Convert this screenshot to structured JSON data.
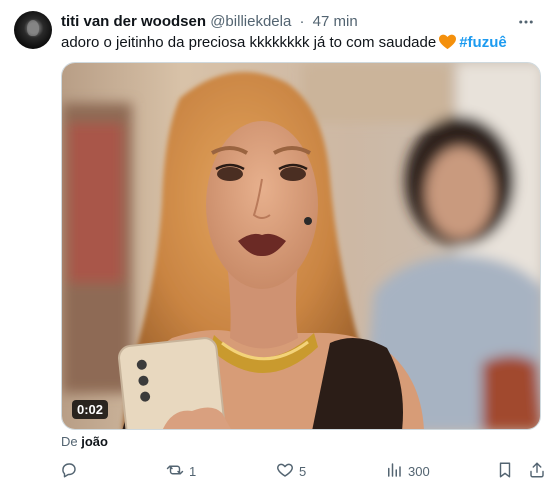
{
  "post": {
    "author_name": "titi van der woodsen",
    "author_handle": "@billiekdela",
    "separator": "·",
    "timestamp": "47 min",
    "text_before_emoji": "adoro o jeitinho da preciosa kkkkkkkk já to com saudade",
    "emoji": "orange-heart",
    "hashtag": "#fuzuê",
    "video_duration": "0:02",
    "from_prefix": "De",
    "from_author": "joão"
  },
  "actions": {
    "reply_count": "",
    "repost_count": "1",
    "like_count": "5",
    "views_count": "300"
  },
  "colors": {
    "link": "#1d9bf0",
    "secondary_text": "#536471",
    "heart_emoji": "#f4900c"
  }
}
